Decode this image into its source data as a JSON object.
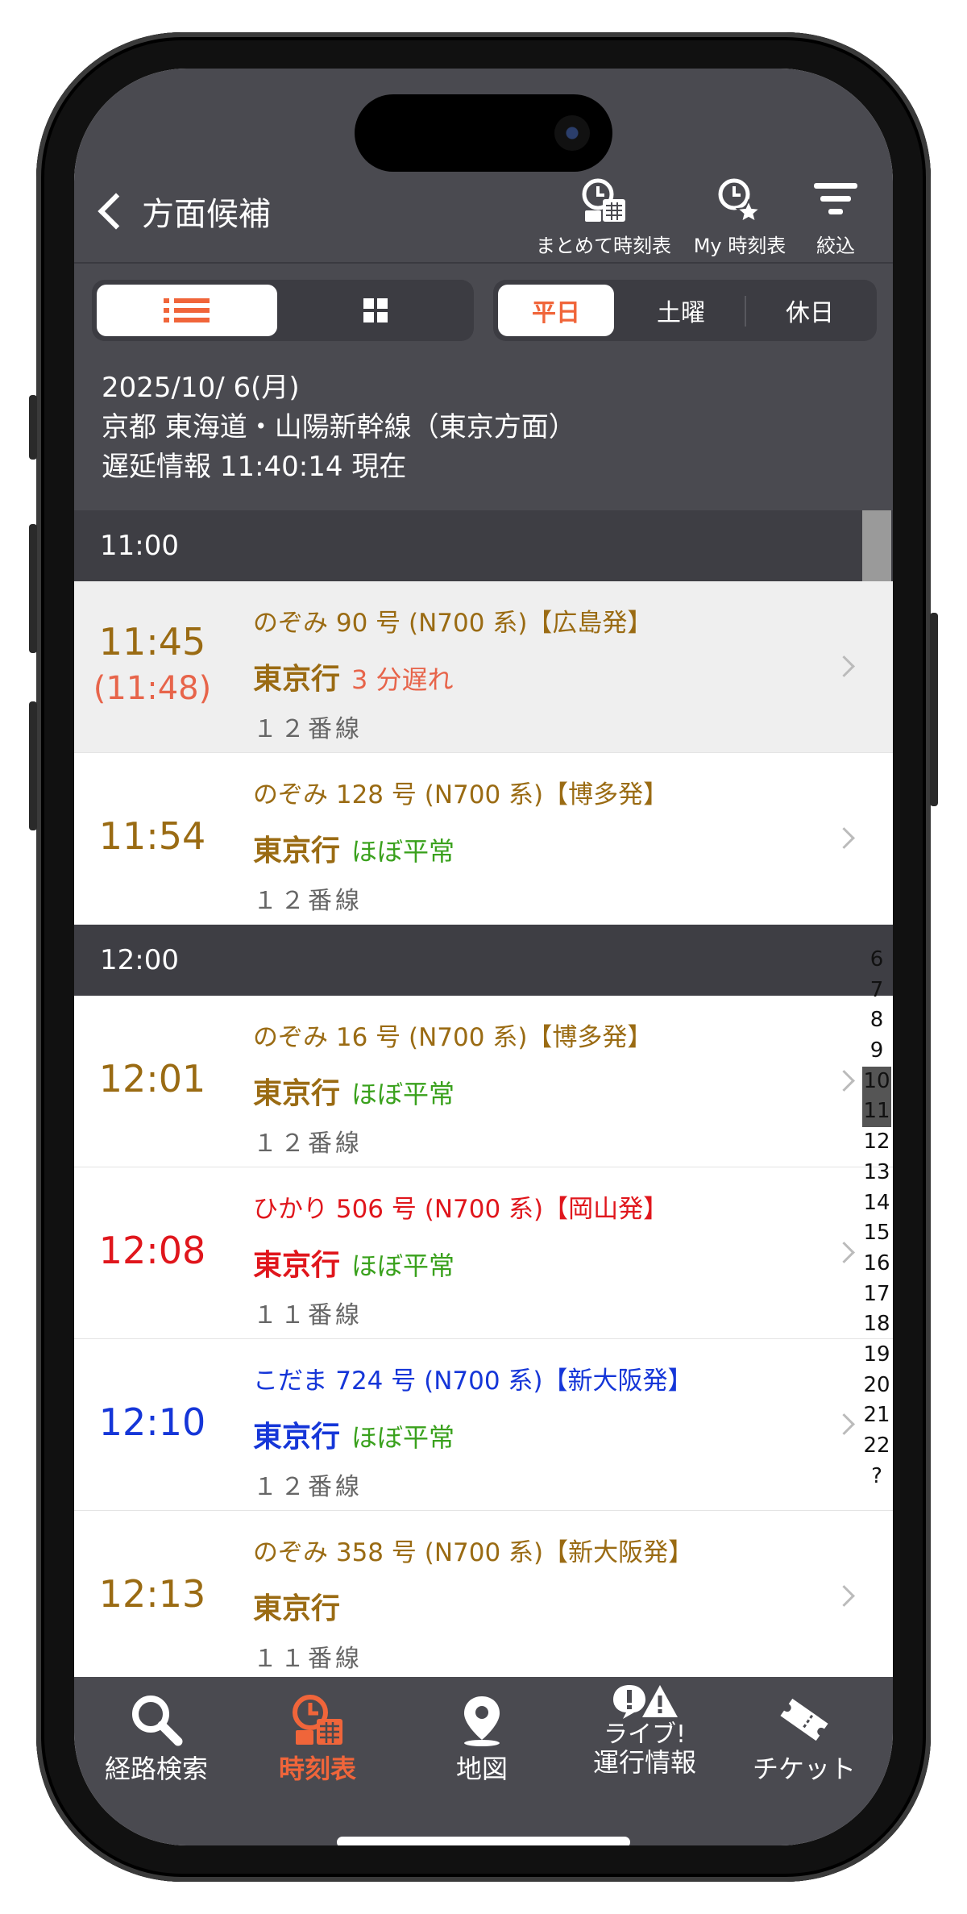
{
  "header": {
    "title": "方面候補",
    "actions": [
      {
        "label": "まとめて時刻表",
        "icon": "combined-timetable-icon"
      },
      {
        "label": "My 時刻表",
        "icon": "my-timetable-icon"
      },
      {
        "label": "絞込",
        "icon": "filter-icon"
      }
    ]
  },
  "view_toggle": {
    "list_icon": "list-icon",
    "grid_icon": "grid-icon",
    "selected": "list"
  },
  "day_tabs": [
    {
      "label": "平日",
      "active": true
    },
    {
      "label": "土曜",
      "active": false
    },
    {
      "label": "休日",
      "active": false
    }
  ],
  "info": {
    "date": "2025/10/ 6(月)",
    "station_line": "京都 東海道・山陽新幹線（東京方面）",
    "delay_info": "遅延情報 11:40:14 現在"
  },
  "sections": [
    {
      "hour": "11:00",
      "trains": [
        {
          "time": "11:45",
          "actual": "(11:48)",
          "train": "のぞみ 90 号 (N700 系)【広島発】",
          "dest": "東京行",
          "status": "3 分遅れ",
          "track": "１２番線",
          "kind": "nozomi",
          "highlight": true
        },
        {
          "time": "11:54",
          "actual": "",
          "train": "のぞみ 128 号 (N700 系)【博多発】",
          "dest": "東京行",
          "status": "ほぼ平常",
          "track": "１２番線",
          "kind": "nozomi",
          "highlight": false
        }
      ]
    },
    {
      "hour": "12:00",
      "trains": [
        {
          "time": "12:01",
          "actual": "",
          "train": "のぞみ 16 号 (N700 系)【博多発】",
          "dest": "東京行",
          "status": "ほぼ平常",
          "track": "１２番線",
          "kind": "nozomi",
          "highlight": false
        },
        {
          "time": "12:08",
          "actual": "",
          "train": "ひかり 506 号 (N700 系)【岡山発】",
          "dest": "東京行",
          "status": "ほぼ平常",
          "track": "１１番線",
          "kind": "hikari",
          "highlight": false
        },
        {
          "time": "12:10",
          "actual": "",
          "train": "こだま 724 号 (N700 系)【新大阪発】",
          "dest": "東京行",
          "status": "ほぼ平常",
          "track": "１２番線",
          "kind": "kodama",
          "highlight": false
        },
        {
          "time": "12:13",
          "actual": "",
          "train": "のぞみ 358 号 (N700 系)【新大阪発】",
          "dest": "東京行",
          "status": "",
          "track": "１１番線",
          "kind": "nozomi",
          "highlight": false
        }
      ]
    }
  ],
  "hour_index": [
    "6",
    "7",
    "8",
    "9",
    "10",
    "11",
    "12",
    "13",
    "14",
    "15",
    "16",
    "17",
    "18",
    "19",
    "20",
    "21",
    "22",
    "?"
  ],
  "hour_index_active": [
    "10",
    "11"
  ],
  "colors": {
    "nozomi": "#9a6b13",
    "hikari": "#e0161c",
    "kodama": "#1536d8",
    "delay": "#e7644a",
    "normal": "#3aa11d",
    "accent": "#f0653a",
    "header_bg": "#4a4a50"
  },
  "tabbar": [
    {
      "label": "経路検索",
      "icon": "search-icon",
      "active": false
    },
    {
      "label": "時刻表",
      "icon": "timetable-icon",
      "active": true
    },
    {
      "label": "地図",
      "icon": "map-pin-icon",
      "active": false
    },
    {
      "label": "ライブ!\n運行情報",
      "label_line1": "ライブ!",
      "label_line2": "運行情報",
      "icon": "alert-icon",
      "active": false
    },
    {
      "label": "チケット",
      "icon": "ticket-icon",
      "active": false
    }
  ]
}
